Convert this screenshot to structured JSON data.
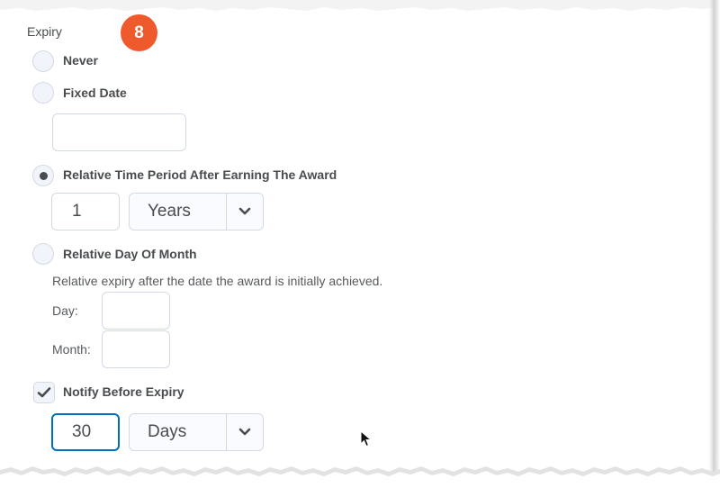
{
  "expiry": {
    "label": "Expiry",
    "step_badge": "8",
    "options": {
      "never": "Never",
      "fixed_date": "Fixed Date",
      "relative_time": "Relative Time Period After Earning The Award",
      "relative_day": "Relative Day Of Month"
    },
    "selected_option": "relative_time",
    "fixed_date_value": "",
    "relative_time": {
      "amount": "1",
      "unit": "Years"
    },
    "relative_day": {
      "helper": "Relative expiry after the date the award is initially achieved.",
      "day_label": "Day:",
      "day_value": "",
      "month_label": "Month:",
      "month_value": ""
    },
    "notify": {
      "label": "Notify Before Expiry",
      "checked": true,
      "amount": "30",
      "unit": "Days"
    }
  },
  "icons": {
    "chevron": "chevron-down-icon",
    "check": "checkmark-icon",
    "cursor": "mouse-pointer-icon"
  },
  "colors": {
    "badge": "#ee5a2c",
    "focus": "#006fbf",
    "text": "#494c4e",
    "border": "#d3d9e3"
  }
}
